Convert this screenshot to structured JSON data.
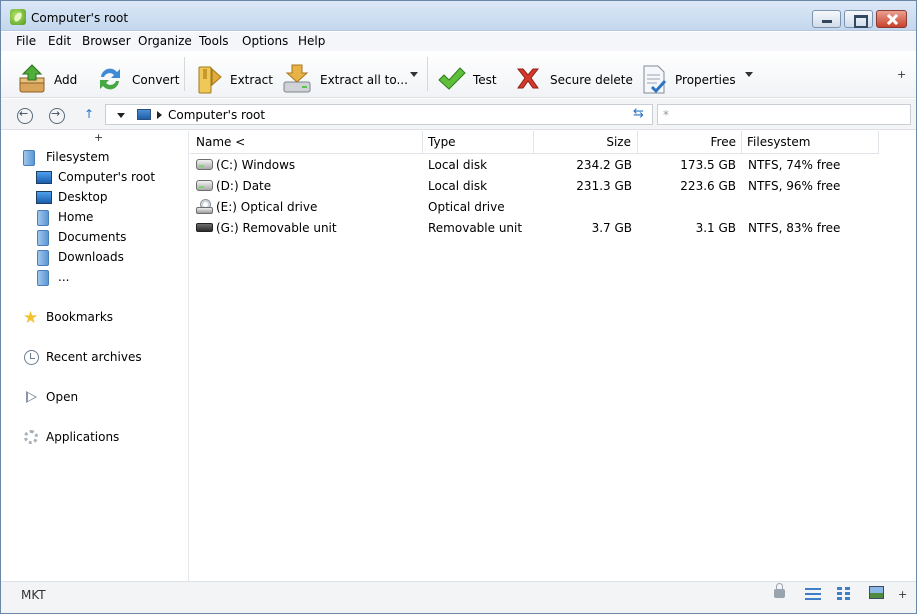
{
  "window": {
    "title": "Computer's root"
  },
  "menu": [
    "File",
    "Edit",
    "Browser",
    "Organize",
    "Tools",
    "Options",
    "Help"
  ],
  "toolbar": {
    "add": "Add",
    "convert": "Convert",
    "extract": "Extract",
    "extract_all": "Extract all to...",
    "test": "Test",
    "secure_delete": "Secure delete",
    "properties": "Properties",
    "more": "+"
  },
  "address": {
    "path": "Computer's root",
    "filter_placeholder": "*"
  },
  "sidebar": {
    "expand": "+",
    "filesystem": "Filesystem",
    "items": [
      "Computer's root",
      "Desktop",
      "Home",
      "Documents",
      "Downloads",
      "..."
    ],
    "bookmarks": "Bookmarks",
    "recent_archives": "Recent archives",
    "open": "Open",
    "applications": "Applications"
  },
  "filelist": {
    "columns": [
      "Name <",
      "Type",
      "Size",
      "Free",
      "Filesystem"
    ],
    "rows": [
      {
        "icon": "hard-disk-icon",
        "name": "(C:) Windows",
        "type": "Local disk",
        "size": "234.2 GB",
        "free": "173.5 GB",
        "filesystem": "NTFS, 74% free"
      },
      {
        "icon": "hard-disk-icon",
        "name": "(D:) Date",
        "type": "Local disk",
        "size": "231.3 GB",
        "free": "223.6 GB",
        "filesystem": "NTFS, 96% free"
      },
      {
        "icon": "optical-drive-icon",
        "name": "(E:) Optical drive",
        "type": "Optical drive",
        "size": "",
        "free": "",
        "filesystem": ""
      },
      {
        "icon": "removable-drive-icon",
        "name": "(G:) Removable unit",
        "type": "Removable unit",
        "size": "3.7 GB",
        "free": "3.1 GB",
        "filesystem": "NTFS, 83% free"
      }
    ]
  },
  "statusbar": {
    "text": "MKT",
    "more": "+"
  },
  "colors": {
    "accent": "#2b74c4",
    "title_bar": "#c4d7ee",
    "close_button": "#c7412b"
  }
}
